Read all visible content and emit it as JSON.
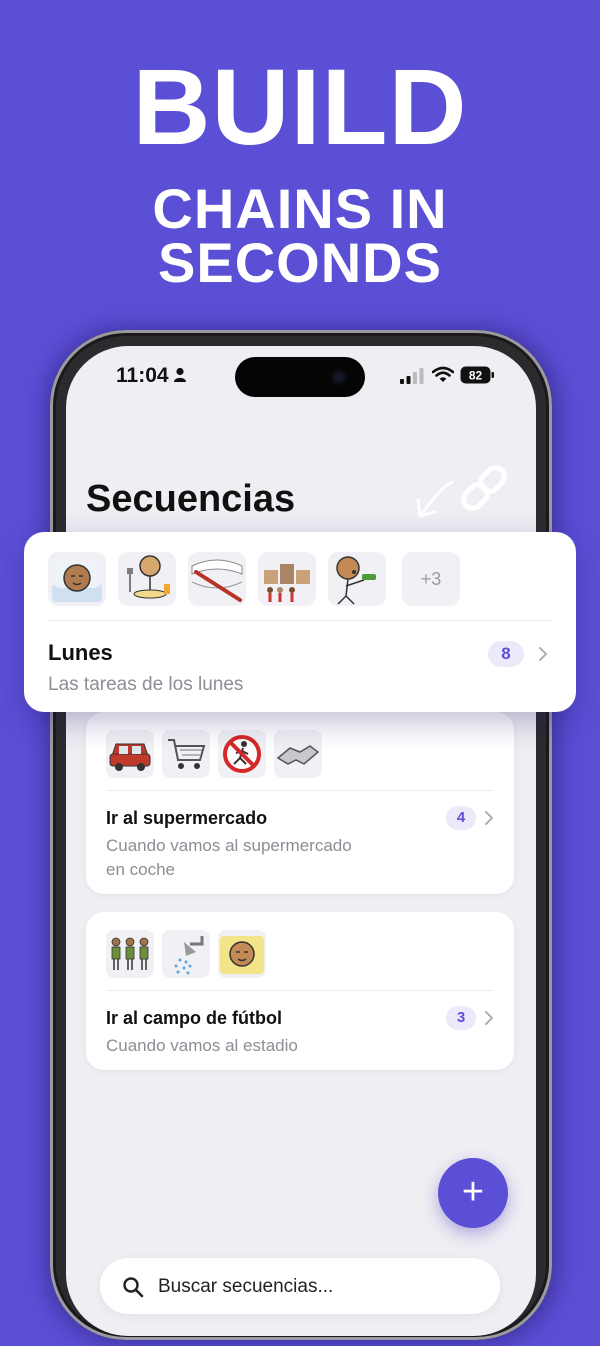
{
  "headline": {
    "line1": "BUILD",
    "line2": "CHAINS IN",
    "line3": "SECONDS"
  },
  "status_bar": {
    "time": "11:04",
    "battery": "82"
  },
  "page": {
    "title": "Secuencias"
  },
  "sequences": [
    {
      "name": "Lunes",
      "description": "Las tareas de los lunes",
      "count": "8",
      "more_label": "+3",
      "pictograms": [
        "sleeping-pictogram",
        "eating-pictogram",
        "toothbrush-pictogram",
        "school-pictogram",
        "singing-pictogram"
      ]
    },
    {
      "name": "Ir al supermercado",
      "description_line1": "Cuando vamos al supermercado",
      "description_line2": "en coche",
      "count": "4",
      "pictograms": [
        "car-pictogram",
        "shopping-cart-pictogram",
        "no-running-pictogram",
        "handshake-pictogram"
      ]
    },
    {
      "name": "Ir al campo de fútbol",
      "description": "Cuando vamos al estadio",
      "count": "3",
      "pictograms": [
        "football-team-pictogram",
        "shower-pictogram",
        "sleeping-pictogram"
      ]
    }
  ],
  "search": {
    "placeholder": "Buscar secuencias..."
  },
  "fab": {
    "label": "+"
  },
  "colors": {
    "accent": "#5b4fd6",
    "background": "#5b4fd6",
    "card": "#ffffff",
    "badge_bg": "#ebe9fa"
  }
}
